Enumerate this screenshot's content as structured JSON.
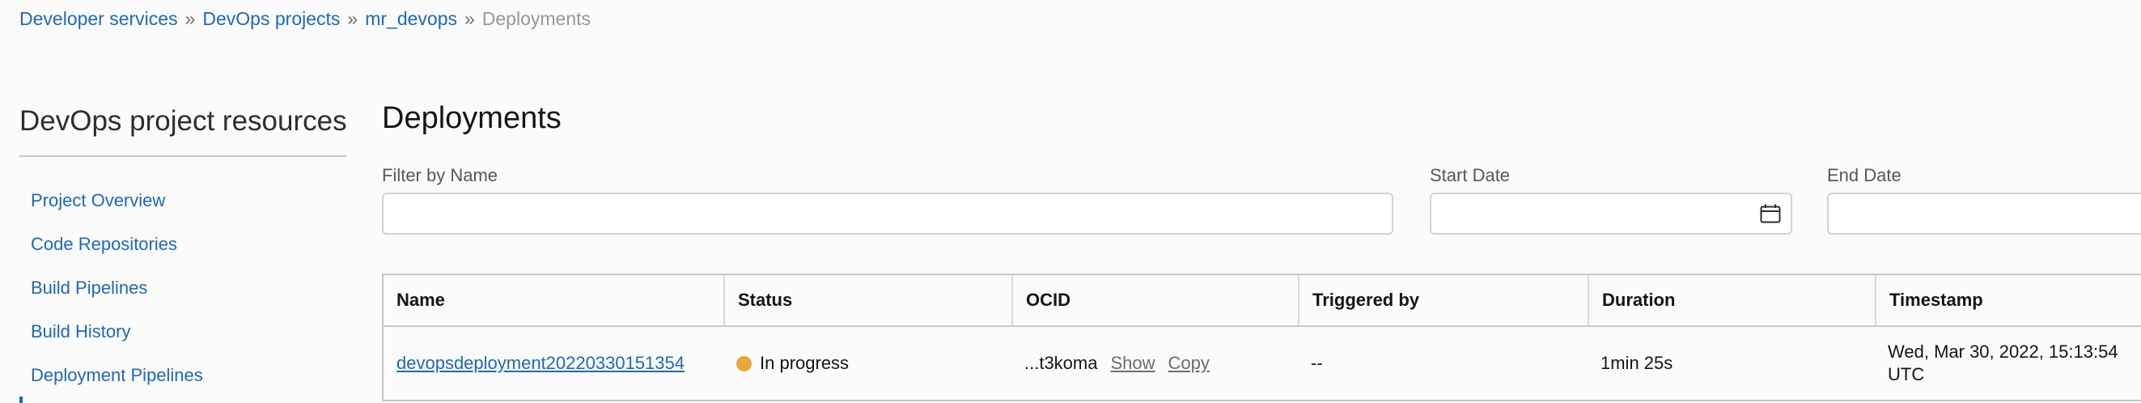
{
  "breadcrumb": {
    "items": [
      "Developer services",
      "DevOps projects",
      "mr_devops"
    ],
    "current": "Deployments",
    "separator": "»"
  },
  "sidebar": {
    "title": "DevOps project resources",
    "items": [
      {
        "label": "Project Overview"
      },
      {
        "label": "Code Repositories"
      },
      {
        "label": "Build Pipelines"
      },
      {
        "label": "Build History"
      },
      {
        "label": "Deployment Pipelines"
      }
    ]
  },
  "main": {
    "title": "Deployments",
    "filters": {
      "name_label": "Filter by Name",
      "name_value": "",
      "start_label": "Start Date",
      "start_value": "",
      "end_label": "End Date",
      "end_value": ""
    },
    "table": {
      "columns": [
        "Name",
        "Status",
        "OCID",
        "Triggered by",
        "Duration",
        "Timestamp"
      ],
      "rows": [
        {
          "name": "devopsdeployment20220330151354",
          "status": "In progress",
          "ocid": "...t3koma",
          "ocid_show": "Show",
          "ocid_copy": "Copy",
          "triggered_by": "--",
          "duration": "1min 25s",
          "timestamp": "Wed, Mar 30, 2022, 15:13:54 UTC"
        }
      ]
    }
  },
  "icons": {
    "calendar": "calendar-icon"
  },
  "colors": {
    "link": "#1e69b8",
    "status_in_progress": "#e6a83a",
    "background": "#fbfbfb"
  }
}
